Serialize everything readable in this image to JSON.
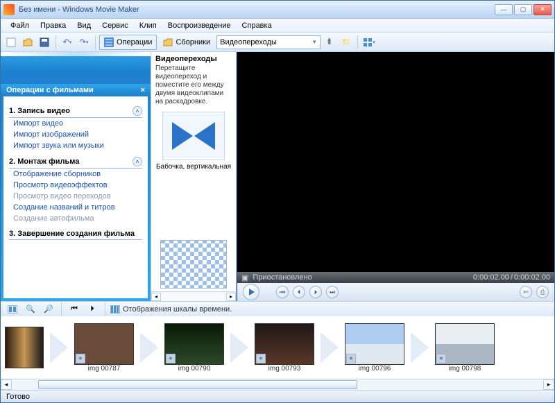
{
  "window": {
    "title": "Без имени - Windows Movie Maker"
  },
  "menu": {
    "file": "Файл",
    "edit": "Правка",
    "view": "Вид",
    "service": "Сервис",
    "clip": "Клип",
    "playback": "Воспроизведение",
    "help": "Справка"
  },
  "toolbar": {
    "operations": "Операции",
    "collections": "Сборники",
    "select_value": "Видеопереходы"
  },
  "tasks": {
    "header": "Операции с фильмами",
    "section1": {
      "title": "1. Запись видео",
      "links": {
        "import_video": "Импорт видео",
        "import_images": "Импорт изображений",
        "import_audio": "Импорт звука или музыки"
      }
    },
    "section2": {
      "title": "2. Монтаж фильма",
      "links": {
        "show_collections": "Отображение сборников",
        "view_effects": "Просмотр видеоэффектов",
        "view_transitions": "Просмотр видео переходов",
        "titles_credits": "Создание названий и титров",
        "automovie": "Создание автофильма"
      }
    },
    "section3": {
      "title": "3. Завершение создания фильма"
    }
  },
  "collections": {
    "title": "Видеопереходы",
    "description": "Перетащите видеопереход и поместите его между двумя видеоклипами на раскадровке.",
    "item1_label": "Бабочка, вертикальная"
  },
  "preview": {
    "status": "Приостановлено",
    "time_current": "0:00:02.00",
    "time_total": "0:00:02.00"
  },
  "timeline": {
    "toolbar_text": "Отображения шкалы времени.",
    "clips": [
      {
        "label": ""
      },
      {
        "label": "img 00787"
      },
      {
        "label": "img 00790"
      },
      {
        "label": "img 00793"
      },
      {
        "label": "img 00796"
      },
      {
        "label": "img 00798"
      }
    ]
  },
  "footer": {
    "status": "Готово"
  }
}
